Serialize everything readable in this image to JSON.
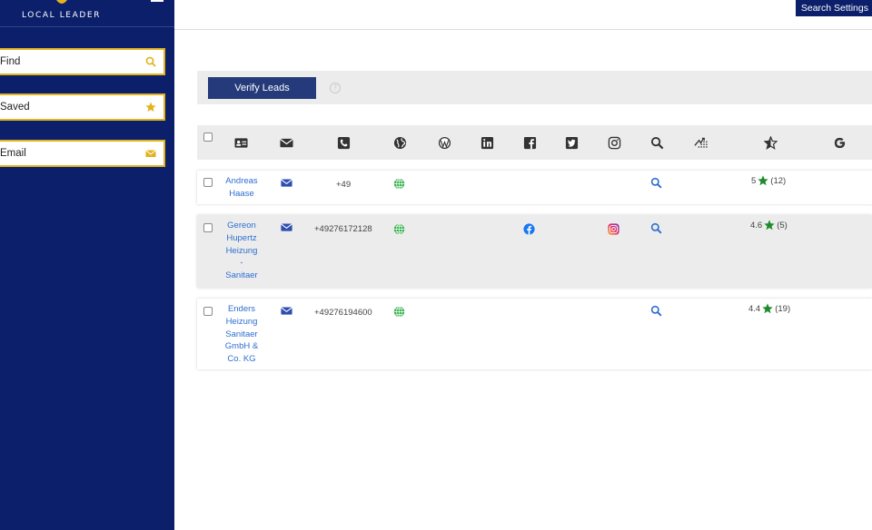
{
  "brand": {
    "name": "LOCAL LEADER"
  },
  "sidebar": {
    "items": [
      {
        "label": "Find",
        "icon": "search-icon"
      },
      {
        "label": "Saved",
        "icon": "star-icon"
      },
      {
        "label": "Email",
        "icon": "envelope-icon"
      }
    ]
  },
  "topbar": {
    "search_settings": "Search Settings"
  },
  "verify": {
    "button_label": "Verify Leads",
    "help": "?"
  },
  "table": {
    "columns": [
      "select",
      "contact-card",
      "email",
      "phone",
      "website",
      "wordpress",
      "linkedin",
      "facebook",
      "twitter",
      "instagram",
      "search",
      "ranking",
      "rating",
      "google"
    ],
    "rows": [
      {
        "name_lines": [
          "Andreas",
          "Haase"
        ],
        "phone": "+49",
        "website": true,
        "facebook": false,
        "instagram": false,
        "rating": "5",
        "reviews": "(12)"
      },
      {
        "name_lines": [
          "Gereon",
          "Hupertz",
          "Heizung",
          "-",
          "Sanitaer"
        ],
        "phone": "+49276172128",
        "website": true,
        "facebook": true,
        "instagram": true,
        "rating": "4.6",
        "reviews": "(5)"
      },
      {
        "name_lines": [
          "Enders",
          "Heizung",
          "Sanitaer",
          "GmbH &",
          "Co. KG"
        ],
        "phone": "+49276194600",
        "website": true,
        "facebook": false,
        "instagram": false,
        "rating": "4.4",
        "reviews": "(19)"
      }
    ]
  },
  "colors": {
    "sidebar_bg": "#0b1f6b",
    "accent_gold": "#e2b31d",
    "link_blue": "#2e6fd1",
    "star_green": "#1f8a2e",
    "button_navy": "#243a7a"
  }
}
